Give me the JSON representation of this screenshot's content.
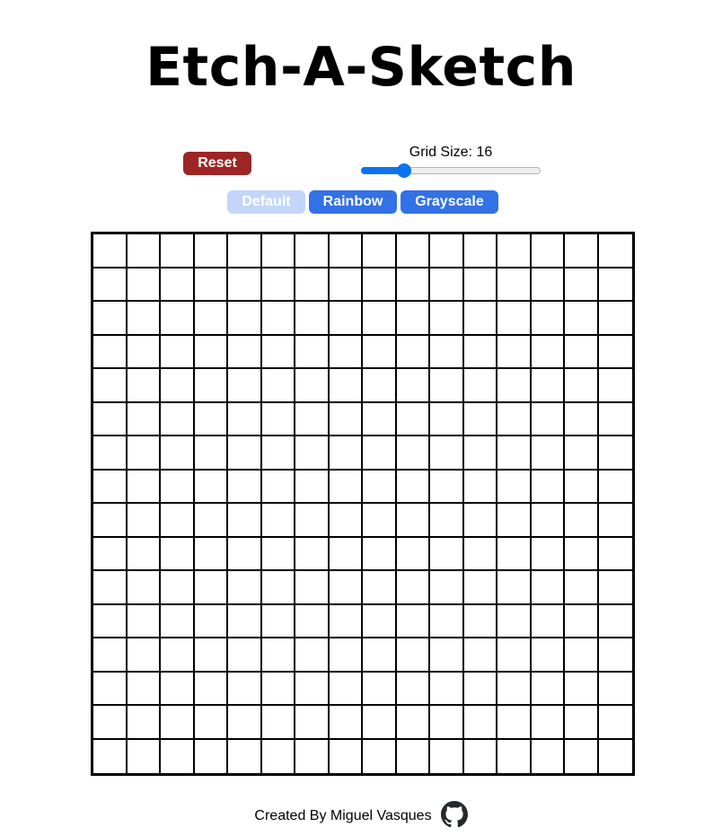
{
  "app": {
    "title": "Etch-A-Sketch"
  },
  "controls": {
    "reset_label": "Reset",
    "grid_size_label": "Grid Size: 16",
    "grid_size": 16,
    "slider": {
      "min": 1,
      "max": 100,
      "value": 16
    },
    "modes": [
      {
        "label": "Default",
        "state": "selected"
      },
      {
        "label": "Rainbow",
        "state": "normal"
      },
      {
        "label": "Grayscale",
        "state": "normal"
      }
    ]
  },
  "footer": {
    "credit": "Created By Miguel Vasques",
    "icon": "github-icon"
  },
  "colors": {
    "reset": "#9e2525",
    "mode_active": "#3271e6",
    "mode_selected": "#c3d6fa",
    "slider_accent": "#0b73f0",
    "grid_line": "#000000"
  }
}
